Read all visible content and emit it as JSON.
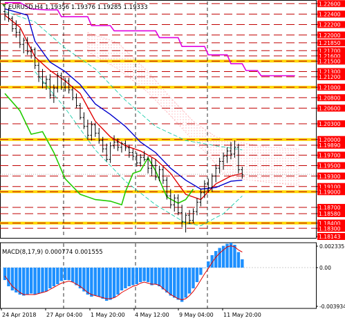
{
  "header": {
    "symbol_label": "EURUSD,H4",
    "ohlc_label": "1.19356 1.19376 1.19285 1.19333",
    "marker_color": "#2a7c1a"
  },
  "indicator": {
    "label": "MACD(8,17,9) 0.000774 0.001555",
    "levels": [
      "0.002335",
      "0.00",
      "-0.003934"
    ],
    "hist_color": "#1e90ff",
    "signal_color": "#e00000"
  },
  "colors": {
    "price_bg": "#ff0000",
    "price_fg": "#ffffff",
    "level_line": "#c00000",
    "key_line": "#ffd700",
    "upper_band": "#e000e0",
    "fast_ma": "#e00000",
    "slow_ma": "#0000cc",
    "lagging": "#22cc00",
    "envelope": "#00c8a0",
    "cloud": "#ff9aa2"
  },
  "chart_data": [
    {
      "type": "candlestick",
      "title": "EURUSD,H4",
      "ylim": [
        1.18143,
        1.2263
      ],
      "y_tick_labels": [
        "1.22600",
        "1.22400",
        "1.22200",
        "1.22000",
        "1.21850",
        "1.21700",
        "1.21600",
        "1.21500",
        "1.21300",
        "1.21200",
        "1.21000",
        "1.20800",
        "1.20600",
        "1.20300",
        "1.20000",
        "1.19890",
        "1.19700",
        "1.19500",
        "1.19300",
        "1.19100",
        "1.19000",
        "1.18700",
        "1.18580",
        "1.18400",
        "1.18300",
        "1.18143"
      ],
      "red_levels": [
        1.226,
        1.224,
        1.222,
        1.22,
        1.2185,
        1.217,
        1.216,
        1.215,
        1.213,
        1.212,
        1.21,
        1.208,
        1.206,
        1.203,
        1.2,
        1.1989,
        1.197,
        1.195,
        1.193,
        1.191,
        1.19,
        1.187,
        1.1858,
        1.184,
        1.183
      ],
      "key_levels": [
        1.215,
        1.21,
        1.2,
        1.19,
        1.184
      ],
      "current_price": 1.19333,
      "x_tick_labels": [
        "24 Apr 2018",
        "27 Apr 04:00",
        "1 May 20:00",
        "4 May 12:00",
        "9 May 04:00",
        "11 May 20:00"
      ],
      "ohlc": [
        [
          1.2245,
          1.2255,
          1.2228,
          1.224
        ],
        [
          1.224,
          1.2252,
          1.2225,
          1.2232
        ],
        [
          1.2232,
          1.2236,
          1.2206,
          1.2212
        ],
        [
          1.2212,
          1.2228,
          1.2195,
          1.2205
        ],
        [
          1.2205,
          1.2212,
          1.2175,
          1.2182
        ],
        [
          1.2182,
          1.2195,
          1.2165,
          1.219
        ],
        [
          1.219,
          1.2196,
          1.2162,
          1.2168
        ],
        [
          1.2168,
          1.2178,
          1.2155,
          1.2172
        ],
        [
          1.2172,
          1.2176,
          1.2135,
          1.2142
        ],
        [
          1.2142,
          1.2148,
          1.211,
          1.212
        ],
        [
          1.212,
          1.2135,
          1.2098,
          1.2108
        ],
        [
          1.2108,
          1.2122,
          1.2095,
          1.2115
        ],
        [
          1.2115,
          1.2125,
          1.2078,
          1.2085
        ],
        [
          1.2085,
          1.2105,
          1.207,
          1.2098
        ],
        [
          1.2098,
          1.2128,
          1.209,
          1.2122
        ],
        [
          1.2122,
          1.2128,
          1.2095,
          1.21
        ],
        [
          1.21,
          1.2118,
          1.2092,
          1.2112
        ],
        [
          1.2112,
          1.2118,
          1.2088,
          1.2095
        ],
        [
          1.2095,
          1.2102,
          1.2075,
          1.208
        ],
        [
          1.208,
          1.2088,
          1.206,
          1.2065
        ],
        [
          1.2065,
          1.207,
          1.2038,
          1.2042
        ],
        [
          1.2042,
          1.2052,
          1.202,
          1.2025
        ],
        [
          1.2025,
          1.2038,
          1.2,
          1.2008
        ],
        [
          1.2008,
          1.2035,
          1.1998,
          1.2028
        ],
        [
          1.2028,
          1.2032,
          1.2005,
          1.2012
        ],
        [
          1.2012,
          1.2022,
          1.1992,
          1.1998
        ],
        [
          1.1998,
          1.2005,
          1.1975,
          1.1982
        ],
        [
          1.1982,
          1.1992,
          1.1958,
          1.1962
        ],
        [
          1.1962,
          1.1995,
          1.1955,
          1.1988
        ],
        [
          1.1988,
          1.2008,
          1.1982,
          1.1995
        ],
        [
          1.1995,
          1.2002,
          1.1978,
          1.1985
        ],
        [
          1.1985,
          1.1996,
          1.1975,
          1.1992
        ],
        [
          1.1992,
          1.1998,
          1.1978,
          1.1984
        ],
        [
          1.1984,
          1.199,
          1.1965,
          1.1975
        ],
        [
          1.1975,
          1.1982,
          1.196,
          1.1968
        ],
        [
          1.1968,
          1.1975,
          1.1948,
          1.1955
        ],
        [
          1.1955,
          1.1972,
          1.1948,
          1.1966
        ],
        [
          1.1966,
          1.1978,
          1.1958,
          1.1962
        ],
        [
          1.1962,
          1.1968,
          1.1935,
          1.1945
        ],
        [
          1.1945,
          1.1965,
          1.193,
          1.195
        ],
        [
          1.195,
          1.1962,
          1.1922,
          1.1928
        ],
        [
          1.1928,
          1.195,
          1.192,
          1.1942
        ],
        [
          1.1942,
          1.1948,
          1.1915,
          1.1922
        ],
        [
          1.1922,
          1.1928,
          1.1885,
          1.1892
        ],
        [
          1.1892,
          1.1905,
          1.1868,
          1.1875
        ],
        [
          1.1875,
          1.1895,
          1.1862,
          1.1888
        ],
        [
          1.1888,
          1.1895,
          1.1855,
          1.186
        ],
        [
          1.186,
          1.1875,
          1.1832,
          1.1842
        ],
        [
          1.1842,
          1.186,
          1.1822,
          1.1855
        ],
        [
          1.1855,
          1.1865,
          1.1838,
          1.1845
        ],
        [
          1.1845,
          1.1868,
          1.184,
          1.1862
        ],
        [
          1.1862,
          1.1888,
          1.1855,
          1.188
        ],
        [
          1.188,
          1.1905,
          1.1872,
          1.1898
        ],
        [
          1.1898,
          1.1922,
          1.1888,
          1.1915
        ],
        [
          1.1915,
          1.1925,
          1.1898,
          1.1908
        ],
        [
          1.1908,
          1.1935,
          1.19,
          1.193
        ],
        [
          1.193,
          1.1952,
          1.1918,
          1.1945
        ],
        [
          1.1945,
          1.1965,
          1.1935,
          1.1958
        ],
        [
          1.1958,
          1.1975,
          1.1942,
          1.1968
        ],
        [
          1.1968,
          1.1985,
          1.1955,
          1.1978
        ],
        [
          1.1978,
          1.1995,
          1.1962,
          1.1972
        ],
        [
          1.1972,
          1.1998,
          1.1965,
          1.1985
        ],
        [
          1.1985,
          1.1992,
          1.1935,
          1.1942
        ],
        [
          1.1942,
          1.1948,
          1.1925,
          1.1933
        ]
      ],
      "series": [
        {
          "role": "upper-band",
          "points": [
            [
              0,
              1.2262
            ],
            [
              4,
              1.2262
            ],
            [
              7,
              1.225
            ],
            [
              11,
              1.2248
            ],
            [
              14,
              1.2248
            ],
            [
              15,
              1.2235
            ],
            [
              22,
              1.2235
            ],
            [
              23,
              1.2218
            ],
            [
              28,
              1.2218
            ],
            [
              29,
              1.2208
            ],
            [
              40,
              1.2208
            ],
            [
              41,
              1.2195
            ],
            [
              46,
              1.2195
            ],
            [
              47,
              1.2178
            ],
            [
              53,
              1.2178
            ],
            [
              54,
              1.2162
            ],
            [
              59,
              1.2162
            ],
            [
              60,
              1.2145
            ],
            [
              63,
              1.2145
            ],
            [
              64,
              1.2132
            ],
            [
              67,
              1.2132
            ],
            [
              68,
              1.2122
            ],
            [
              77,
              1.2122
            ]
          ]
        },
        {
          "role": "fast-ma",
          "points": [
            [
              0,
              1.2238
            ],
            [
              4,
              1.2215
            ],
            [
              8,
              1.2158
            ],
            [
              12,
              1.2132
            ],
            [
              16,
              1.2112
            ],
            [
              20,
              1.2088
            ],
            [
              24,
              1.2035
            ],
            [
              28,
              1.2005
            ],
            [
              32,
              1.1988
            ],
            [
              36,
              1.1978
            ],
            [
              40,
              1.1962
            ],
            [
              44,
              1.1935
            ],
            [
              48,
              1.1895
            ],
            [
              52,
              1.1885
            ],
            [
              56,
              1.1915
            ],
            [
              60,
              1.193
            ],
            [
              63,
              1.1935
            ]
          ]
        },
        {
          "role": "slow-ma",
          "points": [
            [
              0,
              1.225
            ],
            [
              6,
              1.2238
            ],
            [
              8,
              1.2188
            ],
            [
              12,
              1.2148
            ],
            [
              16,
              1.213
            ],
            [
              20,
              1.2105
            ],
            [
              24,
              1.2068
            ],
            [
              28,
              1.2048
            ],
            [
              32,
              1.2025
            ],
            [
              36,
              1.1995
            ],
            [
              40,
              1.1975
            ],
            [
              44,
              1.1945
            ],
            [
              48,
              1.1922
            ],
            [
              52,
              1.1905
            ],
            [
              56,
              1.1908
            ],
            [
              60,
              1.192
            ],
            [
              63,
              1.1922
            ]
          ]
        },
        {
          "role": "lagging",
          "points": [
            [
              0,
              1.2088
            ],
            [
              4,
              1.2055
            ],
            [
              7,
              1.201
            ],
            [
              10,
              1.2015
            ],
            [
              13,
              1.1975
            ],
            [
              16,
              1.1925
            ],
            [
              20,
              1.1895
            ],
            [
              24,
              1.1885
            ],
            [
              28,
              1.1882
            ],
            [
              31,
              1.1875
            ],
            [
              32,
              1.19
            ],
            [
              34,
              1.1935
            ],
            [
              36,
              1.194
            ],
            [
              38,
              1.1965
            ],
            [
              40,
              1.194
            ],
            [
              43,
              1.189
            ],
            [
              46,
              1.1878
            ],
            [
              48,
              1.1885
            ],
            [
              50,
              1.1905
            ]
          ]
        },
        {
          "role": "envelope-upper",
          "points": [
            [
              0,
              1.2245
            ],
            [
              8,
              1.2225
            ],
            [
              16,
              1.2175
            ],
            [
              24,
              1.2135
            ],
            [
              32,
              1.2075
            ],
            [
              40,
              1.2025
            ],
            [
              48,
              1.1998
            ],
            [
              56,
              1.1988
            ],
            [
              63,
              1.198
            ]
          ]
        },
        {
          "role": "envelope-lower",
          "points": [
            [
              8,
              1.213
            ],
            [
              16,
              1.206
            ],
            [
              24,
              1.198
            ],
            [
              32,
              1.192
            ],
            [
              40,
              1.1875
            ],
            [
              48,
              1.184
            ],
            [
              52,
              1.1835
            ],
            [
              58,
              1.1858
            ],
            [
              63,
              1.1892
            ]
          ]
        }
      ]
    },
    {
      "type": "bar",
      "title": "MACD(8,17,9)",
      "ylim": [
        -0.003934,
        0.002335
      ],
      "values": [
        -0.0012,
        -0.0018,
        -0.0022,
        -0.0024,
        -0.0026,
        -0.0027,
        -0.0026,
        -0.0025,
        -0.0026,
        -0.0025,
        -0.0024,
        -0.0023,
        -0.002,
        -0.0018,
        -0.0016,
        -0.0013,
        -0.0012,
        -0.0012,
        -0.0014,
        -0.0017,
        -0.002,
        -0.0023,
        -0.0026,
        -0.0028,
        -0.0027,
        -0.0028,
        -0.003,
        -0.0032,
        -0.0031,
        -0.0029,
        -0.0026,
        -0.0022,
        -0.002,
        -0.0018,
        -0.0017,
        -0.0016,
        -0.0014,
        -0.0013,
        -0.0014,
        -0.0017,
        -0.0016,
        -0.0018,
        -0.0021,
        -0.0024,
        -0.0027,
        -0.0029,
        -0.0031,
        -0.0033,
        -0.0029,
        -0.0025,
        -0.002,
        -0.0014,
        -0.0007,
        0.0,
        0.0006,
        0.0012,
        0.0016,
        0.0019,
        0.0021,
        0.0023,
        0.0024,
        0.0022,
        0.0015,
        0.0008
      ],
      "signal": [
        -0.0008,
        -0.0013,
        -0.0018,
        -0.0021,
        -0.0024,
        -0.0026,
        -0.0026,
        -0.0026,
        -0.0026,
        -0.0025,
        -0.0024,
        -0.0023,
        -0.0021,
        -0.0019,
        -0.0017,
        -0.0015,
        -0.0014,
        -0.0013,
        -0.0014,
        -0.0016,
        -0.0018,
        -0.0021,
        -0.0024,
        -0.0026,
        -0.0027,
        -0.0028,
        -0.0029,
        -0.003,
        -0.003,
        -0.0029,
        -0.0027,
        -0.0024,
        -0.0022,
        -0.002,
        -0.0018,
        -0.0017,
        -0.0015,
        -0.0014,
        -0.0015,
        -0.0016,
        -0.0016,
        -0.0017,
        -0.002,
        -0.0023,
        -0.0026,
        -0.0028,
        -0.003,
        -0.0031,
        -0.003,
        -0.0027,
        -0.0023,
        -0.0018,
        -0.0012,
        -0.0006,
        -0.0001,
        0.0005,
        0.001,
        0.0014,
        0.0017,
        0.002,
        0.0021,
        0.002,
        0.0017,
        0.0015
      ]
    }
  ]
}
